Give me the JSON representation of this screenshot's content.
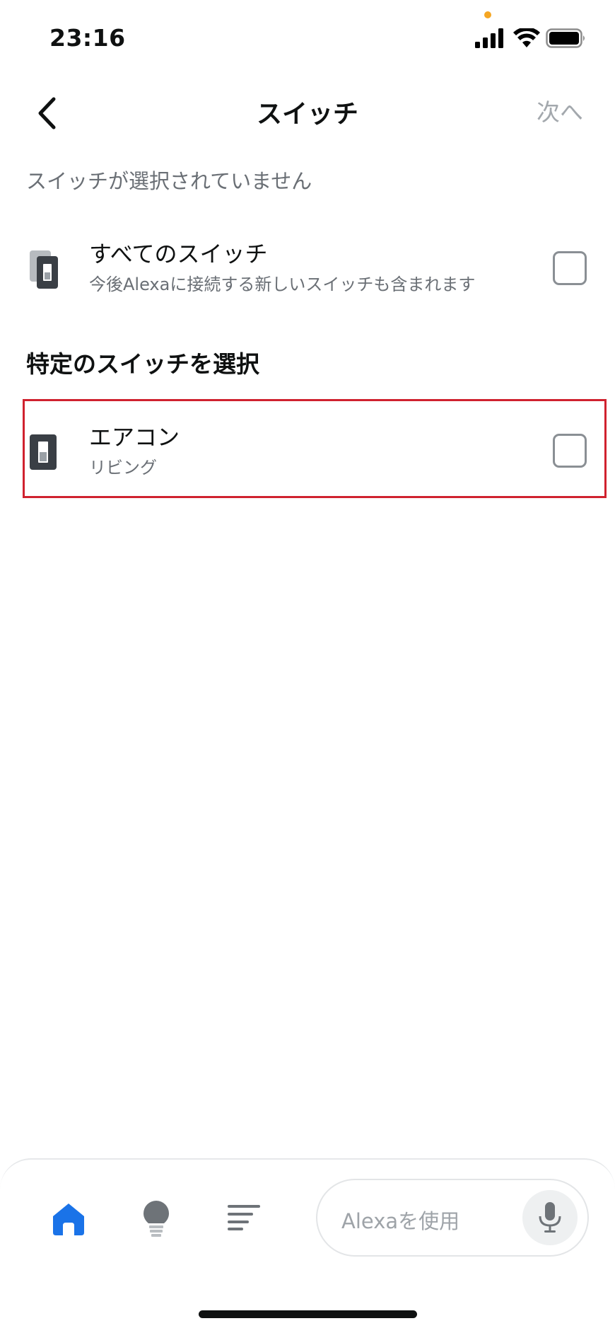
{
  "status_bar": {
    "time": "23:16",
    "icons": [
      "signal-icon",
      "wifi-icon",
      "battery-icon"
    ],
    "privacy_dot_color": "#f5a623"
  },
  "nav": {
    "back_icon": "chevron-left-icon",
    "title": "スイッチ",
    "next_label": "次へ"
  },
  "selection_status": "スイッチが選択されていません",
  "all_switches": {
    "icon": "switches-stack-icon",
    "title": "すべてのスイッチ",
    "subtitle": "今後Alexaに接続する新しいスイッチも含まれます",
    "checked": false
  },
  "specific_section": {
    "heading": "特定のスイッチを選択",
    "items": [
      {
        "icon": "switch-icon",
        "title": "エアコン",
        "subtitle": "リビング",
        "checked": false,
        "highlighted": true
      }
    ]
  },
  "bottom_bar": {
    "tabs": [
      {
        "name": "home",
        "icon": "home-icon",
        "active": true
      },
      {
        "name": "devices",
        "icon": "bulb-icon",
        "active": false
      },
      {
        "name": "more",
        "icon": "menu-lines-icon",
        "active": false
      }
    ],
    "alexa_placeholder": "Alexaを使用",
    "mic_icon": "microphone-icon"
  },
  "colors": {
    "accent": "#1a73e8",
    "highlight_border": "#d0222f",
    "muted_text": "#6a6f75",
    "disabled_text": "#a3a8ad"
  }
}
